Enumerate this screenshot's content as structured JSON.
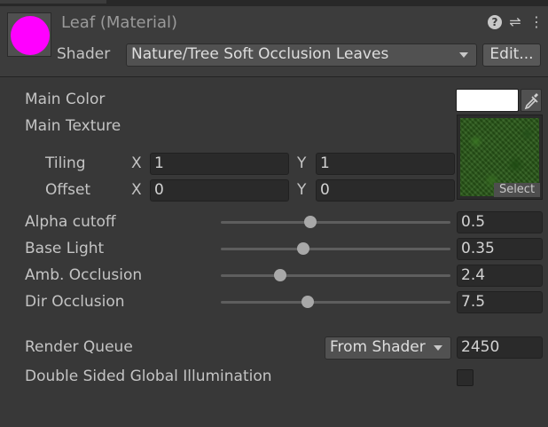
{
  "header": {
    "title": "Leaf (Material)",
    "shader_label": "Shader",
    "shader_value": "Nature/Tree Soft Occlusion Leaves",
    "edit_label": "Edit...",
    "help_glyph": "?",
    "preset_glyph": "⇌",
    "kebab_glyph": "⋮"
  },
  "colors": {
    "preview_sphere": "#ff00ff",
    "main_color": "#ffffff"
  },
  "properties": {
    "main_color_label": "Main Color",
    "main_texture_label": "Main Texture",
    "tiling": {
      "label": "Tiling",
      "x_label": "X",
      "x": "1",
      "y_label": "Y",
      "y": "1"
    },
    "offset": {
      "label": "Offset",
      "x_label": "X",
      "x": "0",
      "y_label": "Y",
      "y": "0"
    },
    "texture_select_label": "Select",
    "sliders": [
      {
        "label": "Alpha cutoff",
        "value": "0.5",
        "fraction": 0.39
      },
      {
        "label": "Base Light",
        "value": "0.35",
        "fraction": 0.36
      },
      {
        "label": "Amb. Occlusion",
        "value": "2.4",
        "fraction": 0.26
      },
      {
        "label": "Dir Occlusion",
        "value": "7.5",
        "fraction": 0.38
      }
    ],
    "render_queue": {
      "label": "Render Queue",
      "mode": "From Shader",
      "value": "2450"
    },
    "double_sided_gi": {
      "label": "Double Sided Global Illumination",
      "checked": false
    }
  }
}
